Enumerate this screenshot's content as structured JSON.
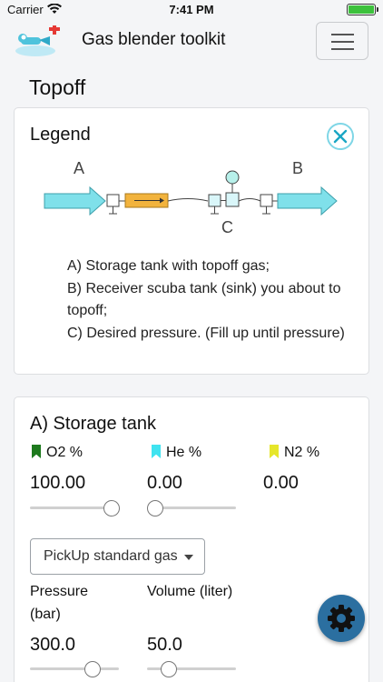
{
  "status_bar": {
    "carrier": "Carrier",
    "time": "7:41 PM"
  },
  "header": {
    "title": "Gas blender toolkit",
    "menu_icon": "hamburger-icon",
    "logo_icon": "diver-logo-icon"
  },
  "page": {
    "title": "Topoff"
  },
  "legend": {
    "title": "Legend",
    "close_icon": "close-icon",
    "diagram": {
      "label_a": "A",
      "label_b": "B",
      "label_c": "C"
    },
    "lines": [
      "A) Storage tank with topoff gas;",
      "B) Receiver scuba tank (sink) you about to topoff;",
      "C) Desired pressure. (Fill up until pressure)"
    ]
  },
  "storage_tank": {
    "title": "A) Storage tank",
    "gases": [
      {
        "label": "O2 %",
        "value": "100.00",
        "flag_color": "#1e7a1e",
        "slider_fraction": 1.0
      },
      {
        "label": "He %",
        "value": "0.00",
        "flag_color": "#3fe3f0",
        "slider_fraction": 0.0
      },
      {
        "label": "N2 %",
        "value": "0.00",
        "flag_color": "#e6e62a"
      }
    ],
    "pickup_button": "PickUp standard gas",
    "pressure": {
      "label": "Pressure (bar)",
      "value": "300.0"
    },
    "volume": {
      "label": "Volume (liter)",
      "value": "50.0"
    }
  },
  "fab": {
    "icon": "gear-icon"
  },
  "colors": {
    "accent": "#2b6fa0",
    "arrow": "#7fe0ea",
    "valve": "#f2b33d"
  }
}
